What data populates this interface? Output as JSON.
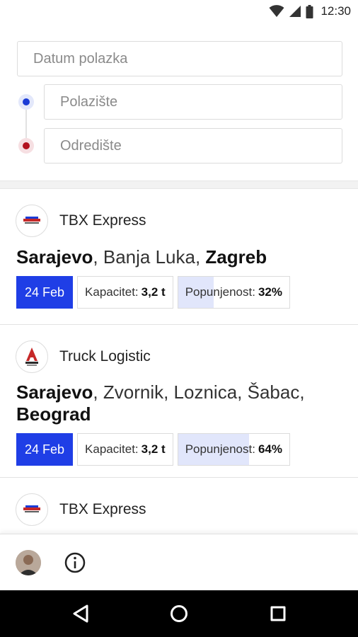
{
  "status_bar": {
    "time": "12:30"
  },
  "search": {
    "date_placeholder": "Datum polazka",
    "from_placeholder": "Polazište",
    "to_placeholder": "Odredište"
  },
  "cards": [
    {
      "company": "TBX Express",
      "logo_icon": "tbx-logo-icon",
      "route_start": "Sarajevo",
      "route_middle": ", Banja Luka, ",
      "route_end": "Zagreb",
      "date": "24 Feb",
      "capacity_label": "Kapacitet:",
      "capacity_value": "3,2 t",
      "fill_label": "Popunjenost:",
      "fill_value": "32%",
      "fill_fraction": 0.32
    },
    {
      "company": "Truck Logistic",
      "logo_icon": "truck-logistic-logo-icon",
      "route_start": "Sarajevo",
      "route_middle": ", Zvornik, Loznica, Šabac, ",
      "route_end": "Beograd",
      "date": "24 Feb",
      "capacity_label": "Kapacitet:",
      "capacity_value": "3,2 t",
      "fill_label": "Popunjenost:",
      "fill_value": "64%",
      "fill_fraction": 0.64
    },
    {
      "company": "TBX Express",
      "logo_icon": "tbx-logo-icon"
    }
  ],
  "bottom_bar": {
    "avatar_icon": "user-avatar",
    "info_icon": "info-icon"
  },
  "nav": {
    "back_icon": "back-triangle-icon",
    "home_icon": "home-circle-icon",
    "recents_icon": "recents-square-icon"
  },
  "colors": {
    "accent": "#1f3ee6",
    "from_dot": "#1a3bd6",
    "to_dot": "#b3121f",
    "fill_track": "#e1e6fb"
  }
}
